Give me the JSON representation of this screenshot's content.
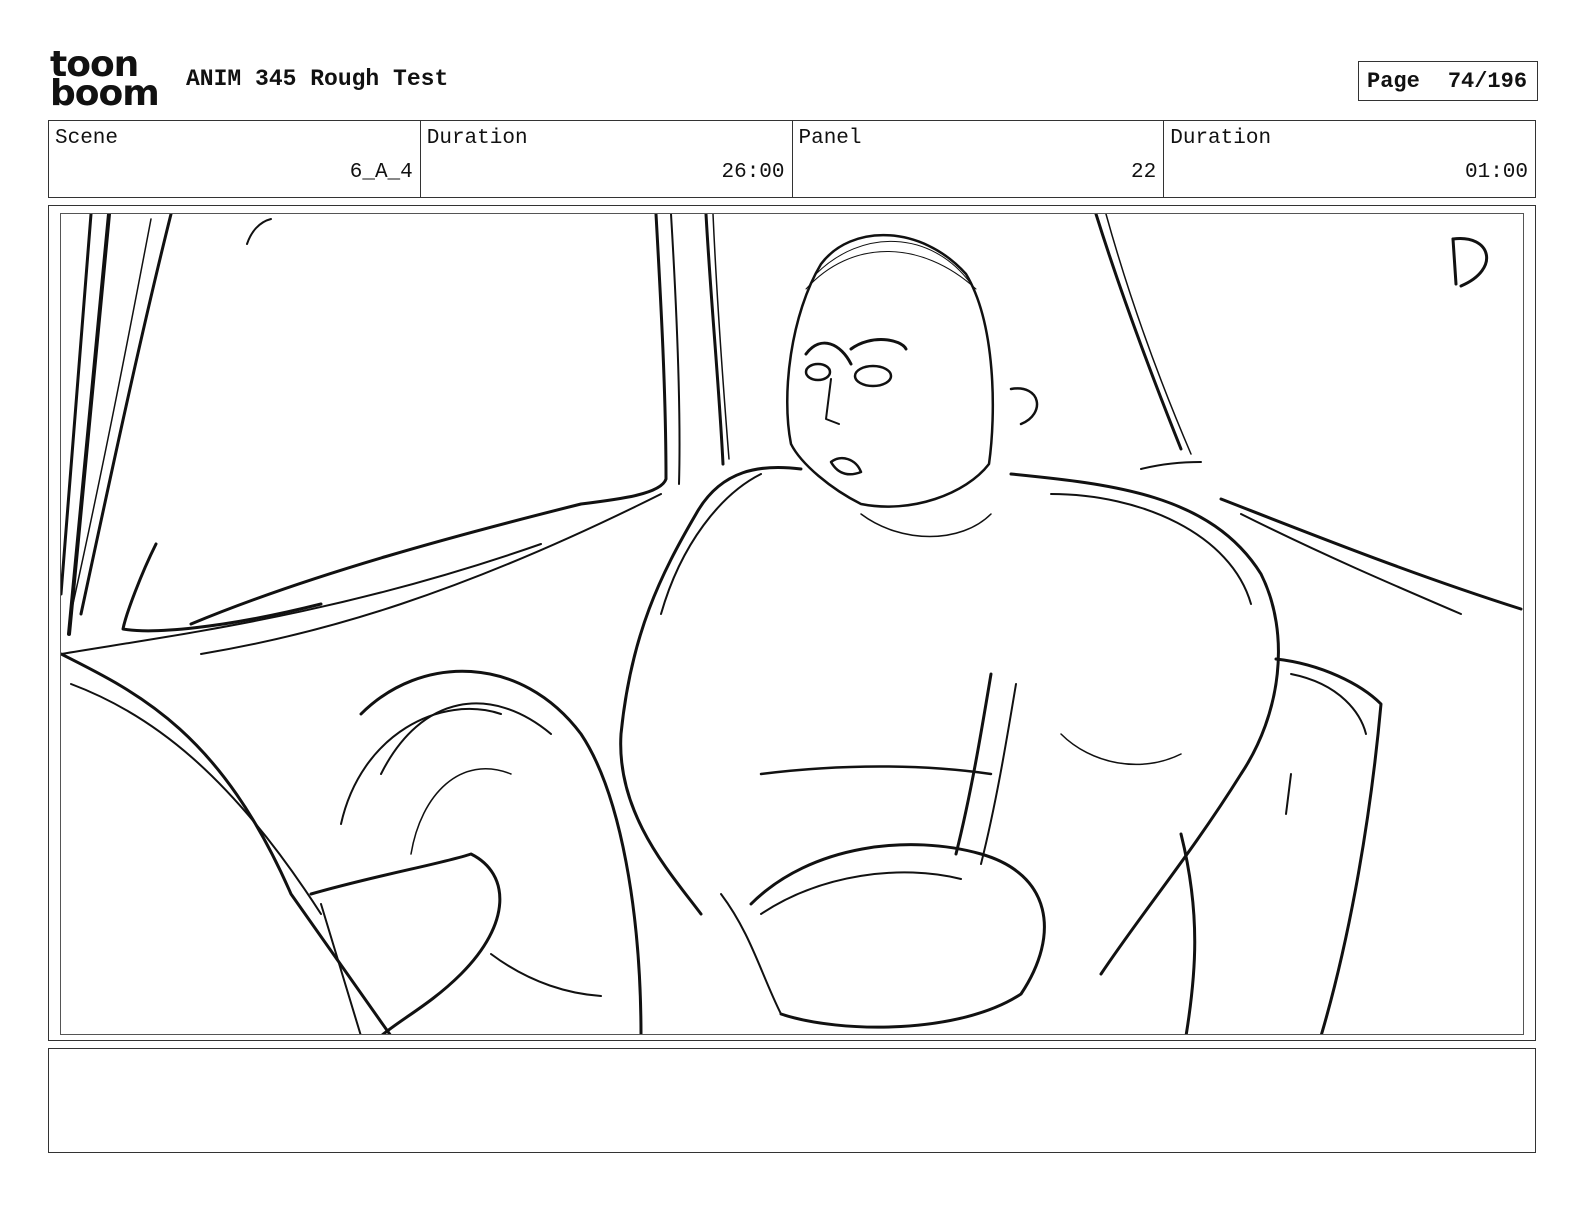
{
  "header": {
    "logo": {
      "top": "toon",
      "bottom": "boom"
    },
    "title": "ANIM 345 Rough Test",
    "page_label": "Page",
    "page_value": "74/196"
  },
  "info": [
    {
      "label": "Scene",
      "value": "6_A_4"
    },
    {
      "label": "Duration",
      "value": "26:00"
    },
    {
      "label": "Panel",
      "value": "22"
    },
    {
      "label": "Duration",
      "value": "01:00"
    }
  ],
  "panel": {
    "corner_mark": "D"
  },
  "notes": {
    "text": ""
  }
}
